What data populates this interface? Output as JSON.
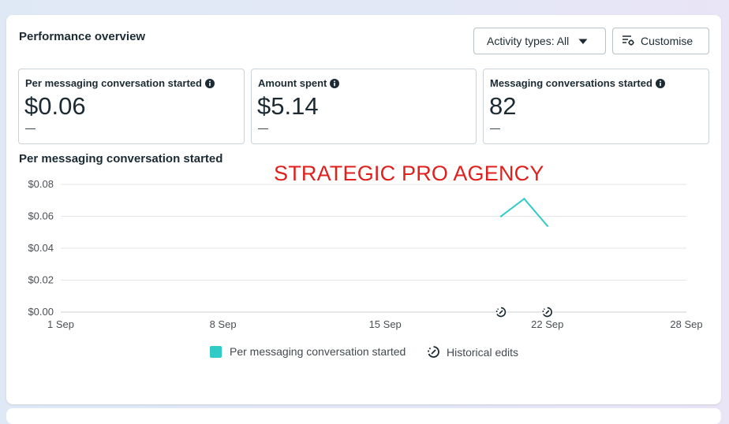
{
  "panel": {
    "title": "Performance overview",
    "activity_button_label": "Activity types: All",
    "customise_button_label": "Customise"
  },
  "metrics": [
    {
      "label": "Per messaging conversation started",
      "value": "$0.06",
      "delta": "—"
    },
    {
      "label": "Amount spent",
      "value": "$5.14",
      "delta": "—"
    },
    {
      "label": "Messaging conversations started",
      "value": "82",
      "delta": "—"
    }
  ],
  "chart_section": {
    "title": "Per messaging conversation started",
    "watermark": "STRATEGIC PRO AGENCY"
  },
  "colors": {
    "series": "#2ecbc7",
    "watermark": "#e0201d"
  },
  "chart_data": {
    "type": "line",
    "title": "Per messaging conversation started",
    "x_ticks": [
      "1 Sep",
      "8 Sep",
      "15 Sep",
      "22 Sep",
      "28 Sep"
    ],
    "y_ticks": [
      "$0.08",
      "$0.06",
      "$0.04",
      "$0.02",
      "$0.00"
    ],
    "ylim": [
      0,
      0.08
    ],
    "x_range_days": [
      1,
      28
    ],
    "series": [
      {
        "name": "Per messaging conversation started",
        "x": [
          "20 Sep",
          "21 Sep",
          "22 Sep"
        ],
        "values": [
          0.06,
          0.071,
          0.054
        ]
      }
    ],
    "historical_edits": [
      "20 Sep",
      "22 Sep"
    ],
    "legend": [
      "Per messaging conversation started",
      "Historical edits"
    ],
    "grid": true,
    "legend_position": "bottom"
  }
}
